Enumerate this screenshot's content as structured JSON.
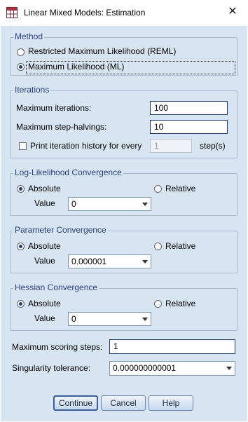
{
  "window": {
    "title": "Linear Mixed Models: Estimation",
    "icon": "spss-grid-icon",
    "close_symbol": "✕",
    "background_color": "#d7e4f2",
    "accent_color": "#2b3f8a"
  },
  "method": {
    "legend": "Method",
    "options": [
      {
        "label": "Restricted Maximum Likelihood (REML)",
        "selected": false
      },
      {
        "label": "Maximum Likelihood (ML)",
        "selected": true
      }
    ]
  },
  "iterations": {
    "legend": "Iterations",
    "max_iterations_label": "Maximum iterations:",
    "max_iterations_value": "100",
    "max_step_halvings_label": "Maximum step-halvings:",
    "max_step_halvings_value": "10",
    "print_history_label": "Print iteration history for every",
    "print_history_checked": false,
    "print_history_value": "1",
    "print_history_unit": "step(s)"
  },
  "log_likelihood": {
    "legend": "Log-Likelihood Convergence",
    "absolute_label": "Absolute",
    "relative_label": "Relative",
    "selected": "Absolute",
    "value_label": "Value",
    "value": "0"
  },
  "parameter": {
    "legend": "Parameter Convergence",
    "absolute_label": "Absolute",
    "relative_label": "Relative",
    "selected": "Absolute",
    "value_label": "Value",
    "value": "0.000001"
  },
  "hessian": {
    "legend": "Hessian Convergence",
    "absolute_label": "Absolute",
    "relative_label": "Relative",
    "selected": "Absolute",
    "value_label": "Value",
    "value": "0"
  },
  "scoring": {
    "label": "Maximum scoring steps:",
    "value": "1"
  },
  "singularity": {
    "label": "Singularity tolerance:",
    "value": "0.000000000001"
  },
  "buttons": {
    "continue": "Continue",
    "cancel": "Cancel",
    "help": "Help"
  }
}
